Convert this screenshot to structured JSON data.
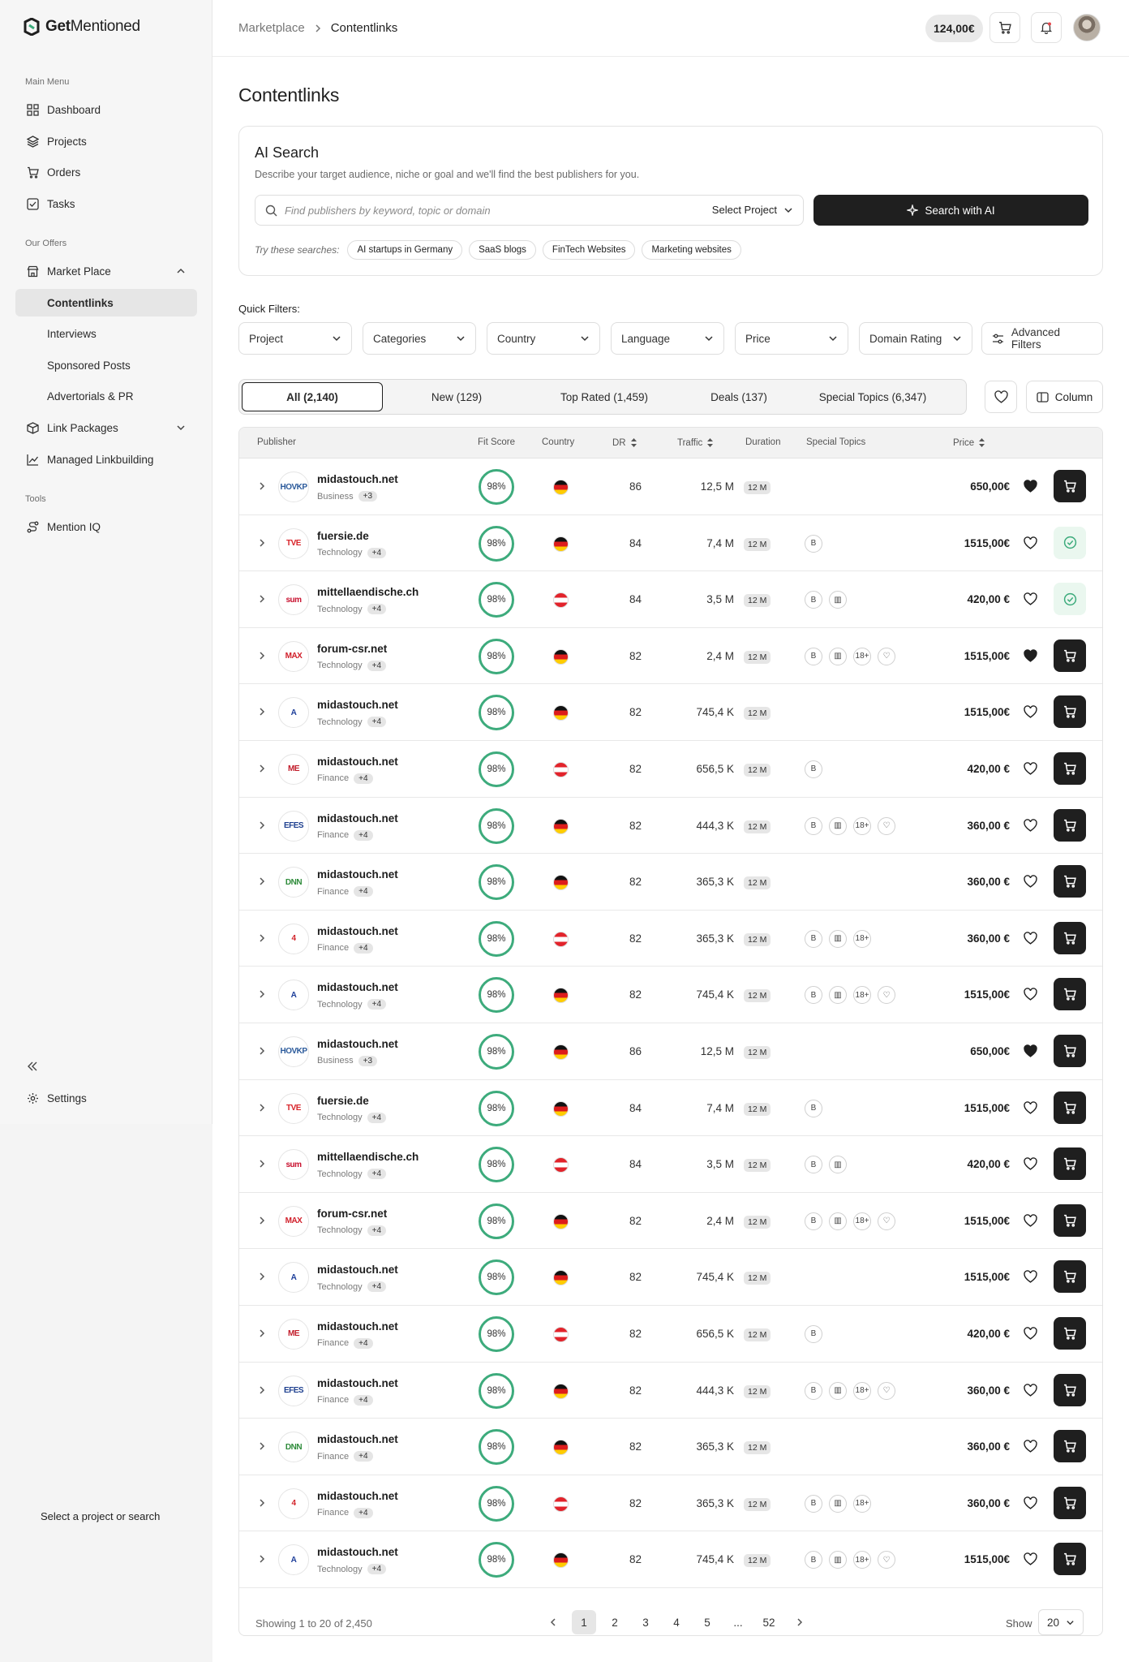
{
  "brand": {
    "name_bold": "Get",
    "name_rest": "Mentioned"
  },
  "sidebar": {
    "main_menu_label": "Main Menu",
    "main_items": [
      {
        "label": "Dashboard",
        "icon": "grid-icon"
      },
      {
        "label": "Projects",
        "icon": "layers-icon"
      },
      {
        "label": "Orders",
        "icon": "cart-icon"
      },
      {
        "label": "Tasks",
        "icon": "checkbox-icon"
      }
    ],
    "offers_label": "Our Offers",
    "offers_items": [
      {
        "label": "Market Place",
        "icon": "store-icon"
      },
      {
        "label": "Contentlinks",
        "active": true
      },
      {
        "label": "Interviews"
      },
      {
        "label": "Sponsored Posts"
      },
      {
        "label": "Advertorials & PR"
      },
      {
        "label": "Link Packages",
        "icon": "package-icon"
      },
      {
        "label": "Managed Linkbuilding",
        "icon": "chart-icon"
      }
    ],
    "tools_label": "Tools",
    "tools_items": [
      {
        "label": "Mention IQ",
        "icon": "route-icon"
      }
    ],
    "settings_label": "Settings",
    "footer_hint": "Select a project or search"
  },
  "header": {
    "breadcrumb": [
      "Marketplace",
      "Contentlinks"
    ],
    "balance": "124,00€"
  },
  "page_title": "Contentlinks",
  "ai_search": {
    "title": "AI Search",
    "description": "Describe your target audience, niche or goal and we'll find the best publishers for you.",
    "placeholder": "Find publishers by keyword, topic or domain",
    "select_project": "Select Project",
    "button": "Search with AI",
    "try_label": "Try these searches:",
    "suggestions": [
      "AI startups in Germany",
      "SaaS blogs",
      "FinTech Websites",
      "Marketing websites"
    ]
  },
  "quick_filters": {
    "label": "Quick Filters:",
    "filters": [
      "Project",
      "Categories",
      "Country",
      "Language",
      "Price",
      "Domain Rating"
    ],
    "advanced": "Advanced Filters"
  },
  "tabs": [
    "All (2,140)",
    "New (129)",
    "Top Rated (1,459)",
    "Deals (137)",
    "Special Topics (6,347)"
  ],
  "column_button": "Column",
  "table": {
    "headers": [
      "Publisher",
      "Fit Score",
      "Country",
      "DR",
      "Traffic",
      "Duration",
      "Special Topics",
      "Price"
    ],
    "rows": [
      {
        "domain": "midastouch.net",
        "logo": "HOVKP",
        "logo_color": "#2b5a9b",
        "category": "Business",
        "extra": "+3",
        "fit": "98%",
        "country": "de",
        "dr": "86",
        "traffic": "12,5 M",
        "duration": "12 M",
        "topics": 0,
        "price": "650,00€",
        "fav": true,
        "added": false
      },
      {
        "domain": "fuersie.de",
        "logo": "TVE",
        "logo_color": "#d8242a",
        "category": "Technology",
        "extra": "+4",
        "fit": "98%",
        "country": "de",
        "dr": "84",
        "traffic": "7,4 M",
        "duration": "12 M",
        "topics": 1,
        "price": "1515,00€",
        "fav": false,
        "added": true
      },
      {
        "domain": "mittellaendische.ch",
        "logo": "sum",
        "logo_color": "#c8102e",
        "category": "Technology",
        "extra": "+4",
        "fit": "98%",
        "country": "at",
        "dr": "84",
        "traffic": "3,5 M",
        "duration": "12 M",
        "topics": 2,
        "price": "420,00 €",
        "fav": false,
        "added": true
      },
      {
        "domain": "forum-csr.net",
        "logo": "MAX",
        "logo_color": "#d1202b",
        "category": "Technology",
        "extra": "+4",
        "fit": "98%",
        "country": "de",
        "dr": "82",
        "traffic": "2,4 M",
        "duration": "12 M",
        "topics": 4,
        "price": "1515,00€",
        "fav": true,
        "added": false
      },
      {
        "domain": "midastouch.net",
        "logo": "A",
        "logo_color": "#1e3f9a",
        "category": "Technology",
        "extra": "+4",
        "fit": "98%",
        "country": "de",
        "dr": "82",
        "traffic": "745,4 K",
        "duration": "12 M",
        "topics": 0,
        "price": "1515,00€",
        "fav": false,
        "added": false
      },
      {
        "domain": "midastouch.net",
        "logo": "ME",
        "logo_color": "#c21d2b",
        "category": "Finance",
        "extra": "+4",
        "fit": "98%",
        "country": "at",
        "dr": "82",
        "traffic": "656,5 K",
        "duration": "12 M",
        "topics": 1,
        "price": "420,00 €",
        "fav": false,
        "added": false
      },
      {
        "domain": "midastouch.net",
        "logo": "EFES",
        "logo_color": "#1d3f8f",
        "category": "Finance",
        "extra": "+4",
        "fit": "98%",
        "country": "de",
        "dr": "82",
        "traffic": "444,3 K",
        "duration": "12 M",
        "topics": 4,
        "price": "360,00 €",
        "fav": false,
        "added": false
      },
      {
        "domain": "midastouch.net",
        "logo": "DNN",
        "logo_color": "#2e8b3a",
        "category": "Finance",
        "extra": "+4",
        "fit": "98%",
        "country": "de",
        "dr": "82",
        "traffic": "365,3 K",
        "duration": "12 M",
        "topics": 0,
        "price": "360,00 €",
        "fav": false,
        "added": false
      },
      {
        "domain": "midastouch.net",
        "logo": "4",
        "logo_color": "#d2232a",
        "category": "Finance",
        "extra": "+4",
        "fit": "98%",
        "country": "at",
        "dr": "82",
        "traffic": "365,3 K",
        "duration": "12 M",
        "topics": 3,
        "price": "360,00 €",
        "fav": false,
        "added": false
      },
      {
        "domain": "midastouch.net",
        "logo": "A",
        "logo_color": "#1e3f9a",
        "category": "Technology",
        "extra": "+4",
        "fit": "98%",
        "country": "de",
        "dr": "82",
        "traffic": "745,4 K",
        "duration": "12 M",
        "topics": 4,
        "price": "1515,00€",
        "fav": false,
        "added": false
      },
      {
        "domain": "midastouch.net",
        "logo": "HOVKP",
        "logo_color": "#2b5a9b",
        "category": "Business",
        "extra": "+3",
        "fit": "98%",
        "country": "de",
        "dr": "86",
        "traffic": "12,5 M",
        "duration": "12 M",
        "topics": 0,
        "price": "650,00€",
        "fav": true,
        "added": false
      },
      {
        "domain": "fuersie.de",
        "logo": "TVE",
        "logo_color": "#d8242a",
        "category": "Technology",
        "extra": "+4",
        "fit": "98%",
        "country": "de",
        "dr": "84",
        "traffic": "7,4 M",
        "duration": "12 M",
        "topics": 1,
        "price": "1515,00€",
        "fav": false,
        "added": false
      },
      {
        "domain": "mittellaendische.ch",
        "logo": "sum",
        "logo_color": "#c8102e",
        "category": "Technology",
        "extra": "+4",
        "fit": "98%",
        "country": "at",
        "dr": "84",
        "traffic": "3,5 M",
        "duration": "12 M",
        "topics": 2,
        "price": "420,00 €",
        "fav": false,
        "added": false
      },
      {
        "domain": "forum-csr.net",
        "logo": "MAX",
        "logo_color": "#d1202b",
        "category": "Technology",
        "extra": "+4",
        "fit": "98%",
        "country": "de",
        "dr": "82",
        "traffic": "2,4 M",
        "duration": "12 M",
        "topics": 4,
        "price": "1515,00€",
        "fav": false,
        "added": false
      },
      {
        "domain": "midastouch.net",
        "logo": "A",
        "logo_color": "#1e3f9a",
        "category": "Technology",
        "extra": "+4",
        "fit": "98%",
        "country": "de",
        "dr": "82",
        "traffic": "745,4 K",
        "duration": "12 M",
        "topics": 0,
        "price": "1515,00€",
        "fav": false,
        "added": false
      },
      {
        "domain": "midastouch.net",
        "logo": "ME",
        "logo_color": "#c21d2b",
        "category": "Finance",
        "extra": "+4",
        "fit": "98%",
        "country": "at",
        "dr": "82",
        "traffic": "656,5 K",
        "duration": "12 M",
        "topics": 1,
        "price": "420,00 €",
        "fav": false,
        "added": false
      },
      {
        "domain": "midastouch.net",
        "logo": "EFES",
        "logo_color": "#1d3f8f",
        "category": "Finance",
        "extra": "+4",
        "fit": "98%",
        "country": "de",
        "dr": "82",
        "traffic": "444,3 K",
        "duration": "12 M",
        "topics": 4,
        "price": "360,00 €",
        "fav": false,
        "added": false
      },
      {
        "domain": "midastouch.net",
        "logo": "DNN",
        "logo_color": "#2e8b3a",
        "category": "Finance",
        "extra": "+4",
        "fit": "98%",
        "country": "de",
        "dr": "82",
        "traffic": "365,3 K",
        "duration": "12 M",
        "topics": 0,
        "price": "360,00 €",
        "fav": false,
        "added": false
      },
      {
        "domain": "midastouch.net",
        "logo": "4",
        "logo_color": "#d2232a",
        "category": "Finance",
        "extra": "+4",
        "fit": "98%",
        "country": "at",
        "dr": "82",
        "traffic": "365,3 K",
        "duration": "12 M",
        "topics": 3,
        "price": "360,00 €",
        "fav": false,
        "added": false
      },
      {
        "domain": "midastouch.net",
        "logo": "A",
        "logo_color": "#1e3f9a",
        "category": "Technology",
        "extra": "+4",
        "fit": "98%",
        "country": "de",
        "dr": "82",
        "traffic": "745,4 K",
        "duration": "12 M",
        "topics": 4,
        "price": "1515,00€",
        "fav": false,
        "added": false
      }
    ]
  },
  "topic_icons": [
    "B",
    "▥",
    "18+",
    "♡"
  ],
  "pagination": {
    "showing": "Showing 1 to 20 of 2,450",
    "pages": [
      "1",
      "2",
      "3",
      "4",
      "5",
      "...",
      "52"
    ],
    "show_label": "Show",
    "per_page": "20"
  },
  "colors": {
    "accent": "#1f1f1f",
    "fit_ring": "#3dab7c",
    "added": "#3dab7c"
  }
}
